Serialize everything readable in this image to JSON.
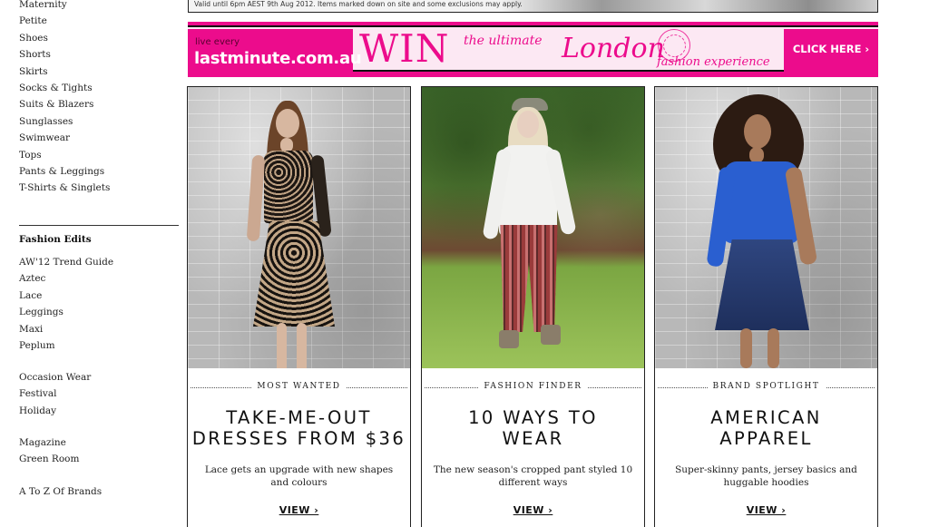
{
  "sidebar": {
    "categories": [
      "Maternity",
      "Petite",
      "Shoes",
      "Shorts",
      "Skirts",
      "Socks & Tights",
      "Suits & Blazers",
      "Sunglasses",
      "Swimwear",
      "Tops",
      "Pants & Leggings",
      "T-Shirts & Singlets"
    ],
    "edits_heading": "Fashion Edits",
    "edits": [
      "AW'12 Trend Guide",
      "Aztec",
      "Lace",
      "Leggings",
      "Maxi",
      "Peplum"
    ],
    "occasions": [
      "Occasion Wear",
      "Festival",
      "Holiday"
    ],
    "editorial": [
      "Magazine",
      "Green Room"
    ],
    "brands_link": "A To Z Of Brands"
  },
  "top_strip": {
    "text": "Valid until 6pm AEST 9th Aug 2012. Items marked down on site and some exclusions may apply."
  },
  "banner": {
    "live_every": "live every",
    "brand": "lastminute.com.au",
    "win": "WIN",
    "ultimate": "the ultimate",
    "london": "London",
    "experience": "fashion experience",
    "cta": "CLICK HERE ›",
    "colors": {
      "pink": "#ec0c8c",
      "pale": "#fce8f3"
    }
  },
  "cards": [
    {
      "kicker": "MOST WANTED",
      "headline_1": "TAKE-ME-OUT",
      "headline_2": "DRESSES FROM $36",
      "blurb": "Lace gets an upgrade with new shapes and colours",
      "cta": "VIEW ›"
    },
    {
      "kicker": "FASHION FINDER",
      "headline_1": "10 WAYS TO",
      "headline_2": "WEAR",
      "blurb": "The new season's cropped pant styled 10 different ways",
      "cta": "VIEW ›"
    },
    {
      "kicker": "BRAND SPOTLIGHT",
      "headline_1": "AMERICAN",
      "headline_2": "APPAREL",
      "blurb": "Super-skinny pants, jersey basics and huggable hoodies",
      "cta": "VIEW ›"
    }
  ]
}
